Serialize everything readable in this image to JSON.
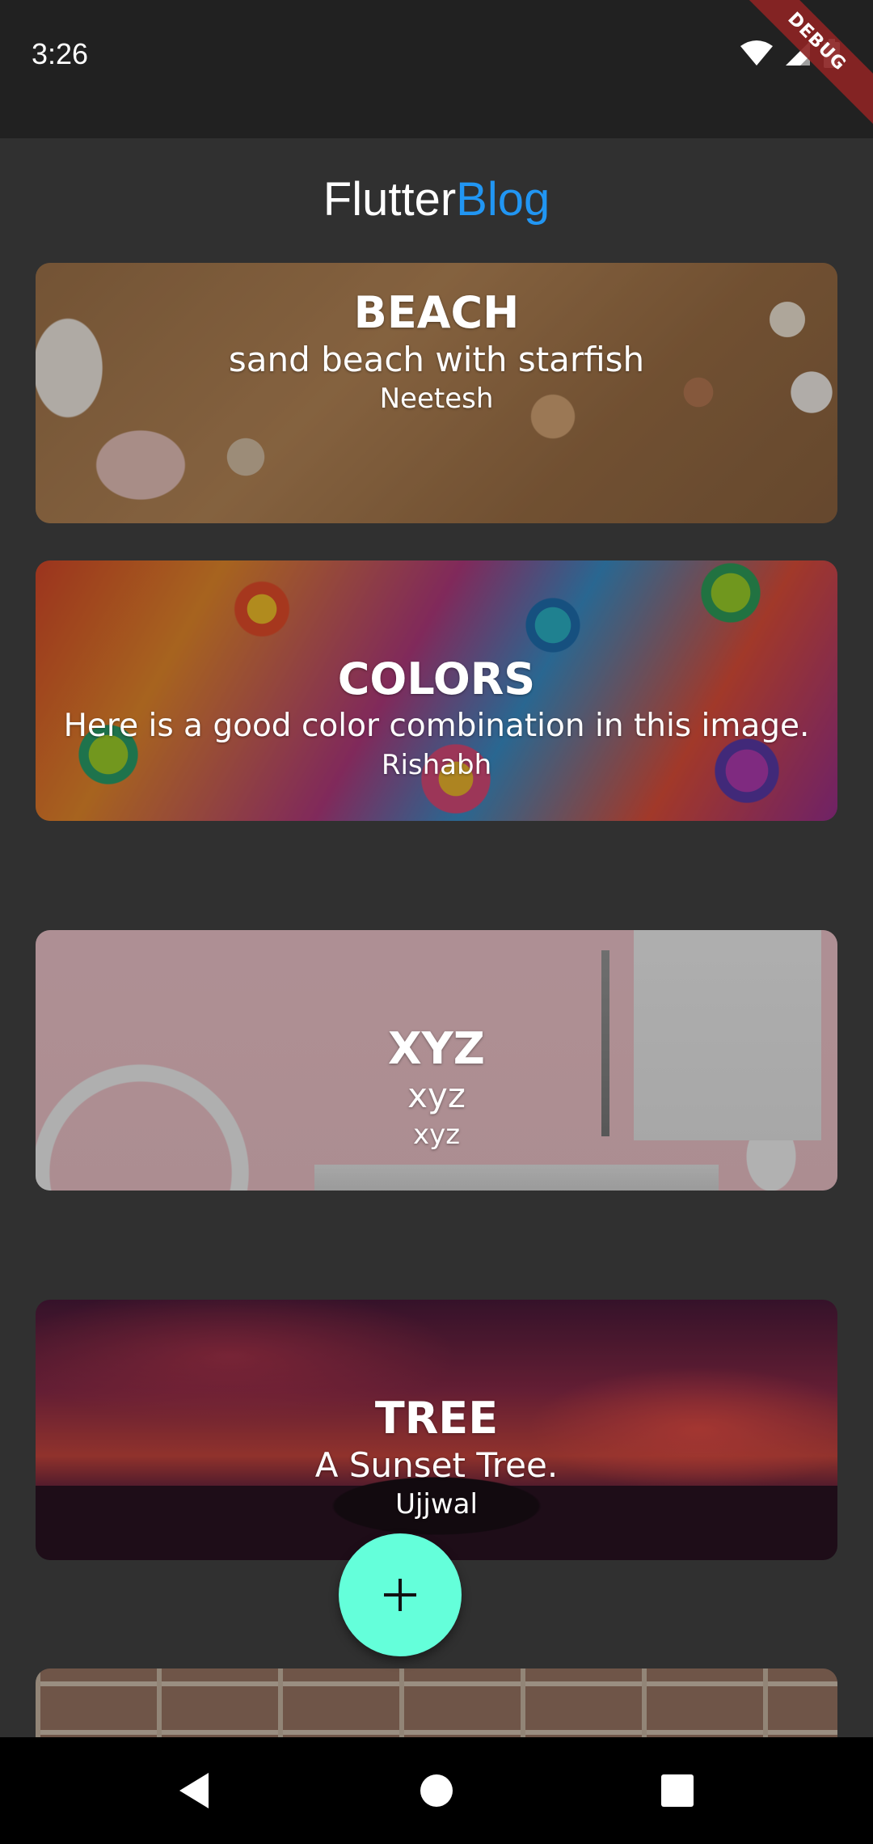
{
  "status_bar": {
    "time": "3:26",
    "debug_label": "DEBUG"
  },
  "app_bar": {
    "title_part1": "Flutter",
    "title_part2": "Blog",
    "title_part2_color": "#2196f3"
  },
  "posts": [
    {
      "title": "BEACH",
      "description": "sand beach with starfish",
      "author": "Neetesh",
      "image": "beach-image"
    },
    {
      "title": "COLORS",
      "description": "Here is a good color combination in this image.",
      "author": "Rishabh",
      "image": "colors-image"
    },
    {
      "title": "XYZ",
      "description": "xyz",
      "author": "xyz",
      "image": "desk-image"
    },
    {
      "title": "TREE",
      "description": "A Sunset Tree.",
      "author": "Ujjwal",
      "image": "sunset-tree-image"
    },
    {
      "title": "",
      "description": "",
      "author": "",
      "image": "brick-wall-image"
    }
  ],
  "fab": {
    "icon": "plus-icon",
    "color": "#64ffda"
  },
  "nav_bar": {
    "icons": [
      "back-icon",
      "home-icon",
      "recents-icon"
    ]
  }
}
